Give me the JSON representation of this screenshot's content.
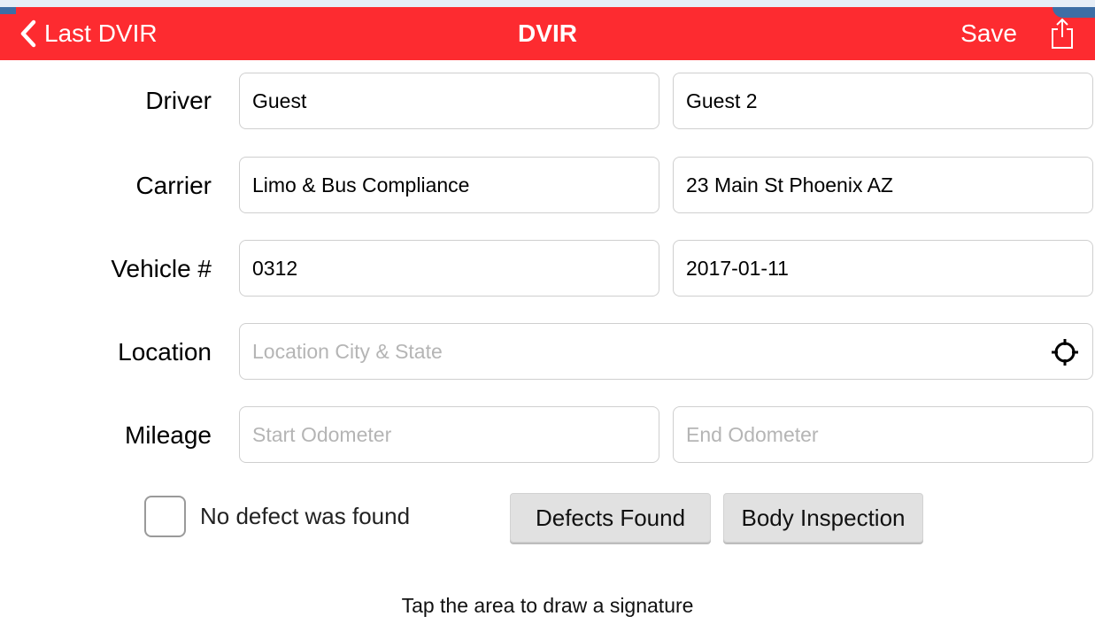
{
  "nav": {
    "back_label": "Last DVIR",
    "title": "DVIR",
    "save_label": "Save"
  },
  "form": {
    "driver": {
      "label": "Driver",
      "first_value": "Guest",
      "second_value": "Guest 2"
    },
    "carrier": {
      "label": "Carrier",
      "name_value": "Limo & Bus Compliance",
      "address_value": "23 Main St Phoenix AZ"
    },
    "vehicle": {
      "label": "Vehicle #",
      "number_value": "0312",
      "date_value": "2017-01-11"
    },
    "location": {
      "label": "Location",
      "value": "",
      "placeholder": "Location City & State"
    },
    "mileage": {
      "label": "Mileage",
      "start_value": "",
      "start_placeholder": "Start Odometer",
      "end_value": "",
      "end_placeholder": "End Odometer"
    }
  },
  "inspection": {
    "no_defect_label": "No defect was found",
    "no_defect_checked": false,
    "defects_found_label": "Defects Found",
    "body_inspection_label": "Body Inspection"
  },
  "signature": {
    "hint": "Tap the area to draw a signature"
  },
  "theme": {
    "accent": "#fd2b30",
    "nav_text": "#ffffff",
    "placeholder": "#b5b5b5"
  },
  "icons": {
    "back": "chevron-left-icon",
    "share": "share-icon",
    "location": "crosshair-icon",
    "checkbox": "checkbox-icon"
  }
}
